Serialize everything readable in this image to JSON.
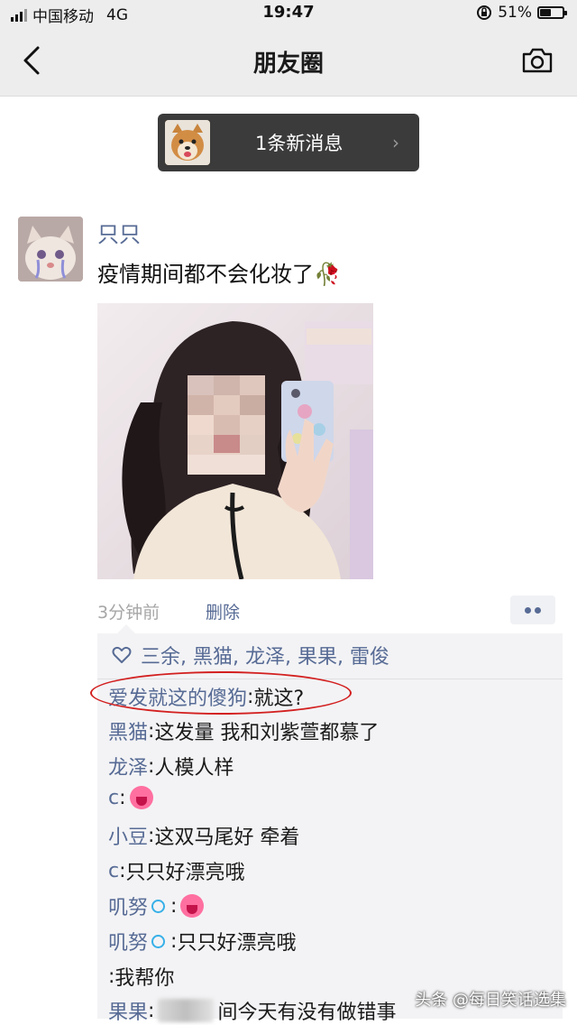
{
  "status_bar": {
    "carrier": "中国移动",
    "network": "4G",
    "time": "19:47",
    "battery_percent": "51%",
    "battery_level": 0.51
  },
  "nav": {
    "title": "朋友圈",
    "back_icon": "chevron-left-icon",
    "camera_icon": "camera-icon"
  },
  "new_message": {
    "label": "1条新消息",
    "chevron": "›"
  },
  "post": {
    "author": "只只",
    "text": "疫情期间都不会化妆了🥀",
    "time": "3分钟前",
    "delete_label": "删除",
    "likes": {
      "icon": "heart-outline-icon",
      "names": "三余, 黑猫, 龙泽, 果果, 雷俊"
    },
    "comments": [
      {
        "author": "爱发就这的傻狗",
        "sep": ": ",
        "text": "就这?"
      },
      {
        "author": "黑猫",
        "sep": ": ",
        "text": "这发量 我和刘紫萱都慕了"
      },
      {
        "author": "龙泽",
        "sep": ": ",
        "text": "人模人样"
      },
      {
        "author": "c",
        "sep": ": ",
        "text": ""
      },
      {
        "author": "小豆",
        "sep": ": ",
        "text": "这双马尾好 牵着"
      },
      {
        "author": "c",
        "sep": ": ",
        "text": "只只好漂亮哦"
      },
      {
        "author": "叽努",
        "sep": ": ",
        "text": ""
      },
      {
        "author": "叽努",
        "sep": ": ",
        "text": "只只好漂亮哦"
      },
      {
        "author": "",
        "sep": ": ",
        "text": "我帮你"
      },
      {
        "author": "果果",
        "sep": ": ",
        "text": "间今天有没有做错事"
      }
    ]
  },
  "watermark": "头条 @每日笑话选集",
  "colors": {
    "link_blue": "#576b95",
    "nav_bg": "#ededed",
    "banner_bg": "#3b3b3b",
    "highlight_red": "#d32020"
  }
}
